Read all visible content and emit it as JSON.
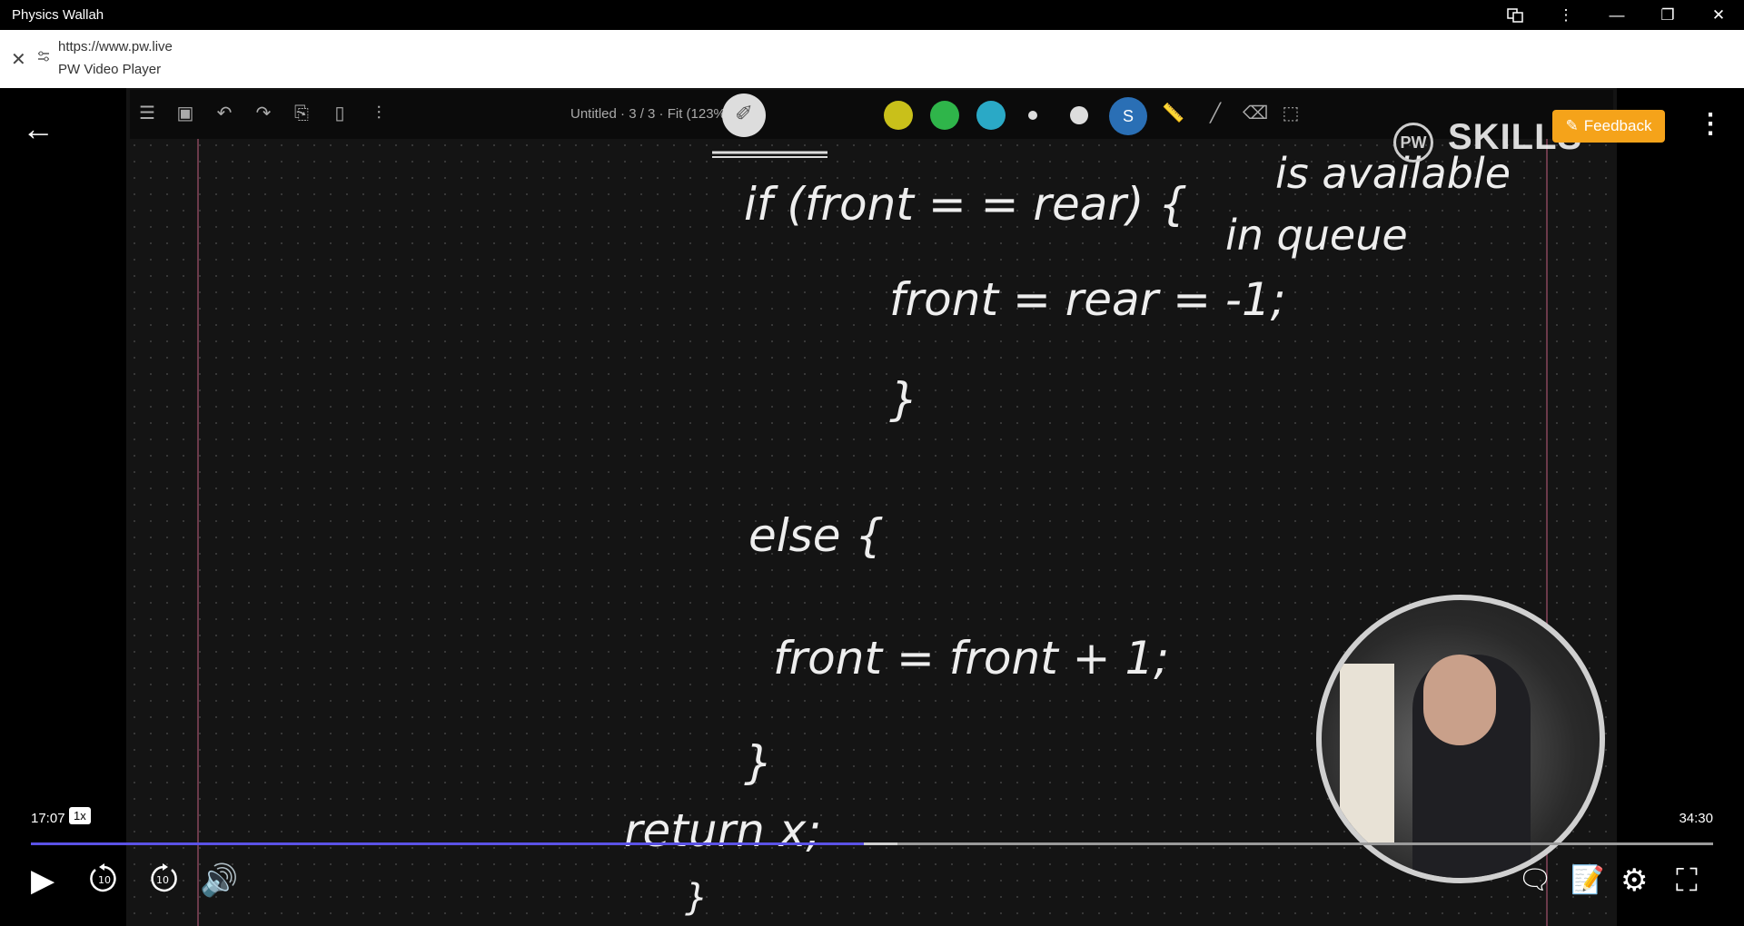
{
  "window": {
    "title": "Physics Wallah"
  },
  "address": {
    "url": "https://www.pw.live",
    "page_name": "PW Video Player"
  },
  "board": {
    "doc_info": "Untitled  ·  3 / 3  ·  Fit (123%)",
    "watermark": "SKILLS",
    "watermark_logo": "PW",
    "handwriting": [
      "if (front = = rear) {",
      "is available",
      "in queue",
      "front = rear = -1;",
      "}",
      "else {",
      "front = front + 1;",
      "}",
      "return x;",
      "}"
    ]
  },
  "overlay": {
    "feedback_label": "Feedback"
  },
  "player": {
    "current_time": "17:07",
    "speed": "1x",
    "total_time": "34:30",
    "progress_fraction": 0.495,
    "buffered_fraction": 0.515,
    "rewind_label": "10",
    "forward_label": "10"
  },
  "colors": {
    "progress": "#5b52e6",
    "feedback": "#f5a31a",
    "pen_yellow": "#c9c01a",
    "pen_green": "#2fb54a",
    "pen_teal": "#2aa9c6"
  }
}
